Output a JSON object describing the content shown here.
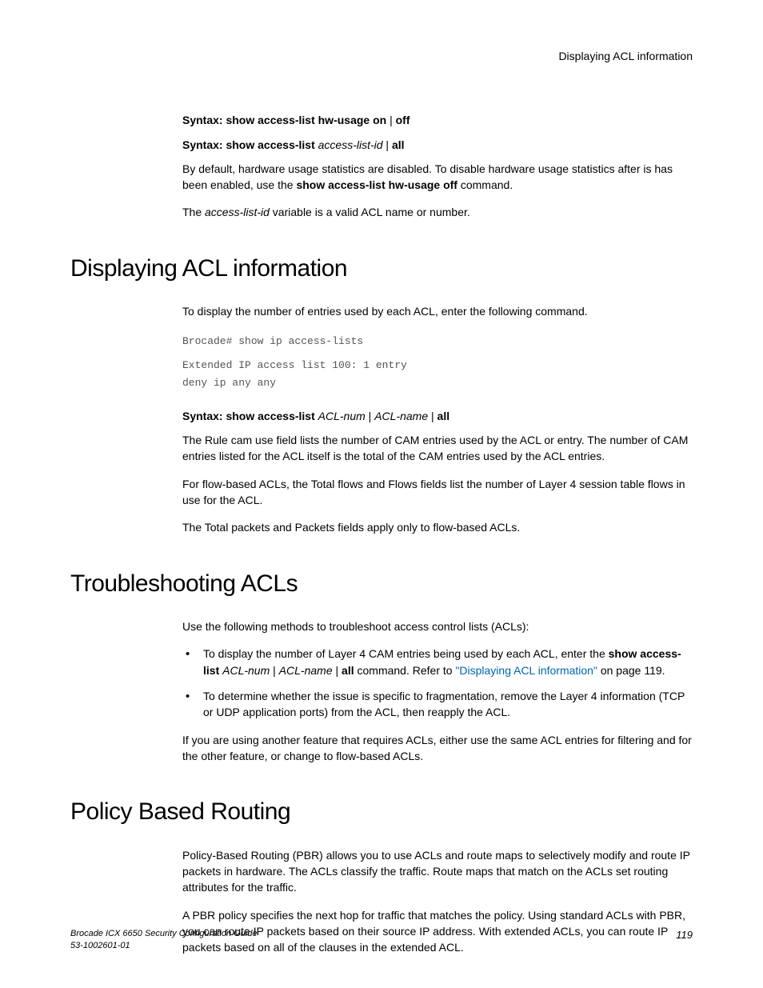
{
  "header": {
    "right": "Displaying ACL information"
  },
  "intro": {
    "syntax1": {
      "prefix": "Syntax:  ",
      "cmd": "show access-list hw-usage on",
      "sep": " | ",
      "off": "off"
    },
    "syntax2": {
      "prefix": "Syntax:  ",
      "cmd": "show access-list ",
      "var": "access-list-id",
      "sep": " | ",
      "all": "all"
    },
    "para1a": "By default, hardware usage statistics are disabled. To disable hardware usage statistics after is has been enabled, use the ",
    "para1b": "show access-list hw-usage off",
    "para1c": " command.",
    "para2a": "The ",
    "para2b": "access-list-id",
    "para2c": " variable is a valid ACL name or number."
  },
  "sec1": {
    "title": "Displaying ACL information",
    "p1": "To display the number of entries used by each ACL, enter the following command.",
    "code1": "Brocade# show ip access-lists",
    "code2": "Extended IP access list 100: 1 entry",
    "code3": "deny ip any any",
    "syntax": {
      "prefix": "Syntax:  ",
      "cmd": "show access-list ",
      "var1": "ACL-num",
      "sep1": " | ",
      "var2": "ACL-name",
      "sep2": " | ",
      "all": "all"
    },
    "p2": "The Rule cam use field lists the number of CAM entries used by the ACL or entry. The number of CAM entries listed for the ACL itself is the total of the CAM entries used by the ACL entries.",
    "p3": "For flow-based ACLs, the Total flows and Flows fields list the number of Layer 4 session table flows in use for the ACL.",
    "p4": "The Total packets and Packets fields apply only to flow-based ACLs."
  },
  "sec2": {
    "title": "Troubleshooting ACLs",
    "p1": "Use the following methods to troubleshoot access control lists (ACLs):",
    "li1a": "To display the number of Layer 4 CAM entries being used by each ACL, enter the ",
    "li1b": "show access-list ",
    "li1c": "ACL-num",
    "li1d": " | ",
    "li1e": "ACL-name",
    "li1f": " | ",
    "li1g": "all",
    "li1h": " command. Refer to ",
    "li1link": "\"Displaying ACL information\"",
    "li1i": " on page 119.",
    "li2": "To determine whether the issue is specific to fragmentation, remove the Layer 4 information (TCP or UDP application ports) from the ACL, then reapply the ACL.",
    "p2": "If you are using another feature that requires ACLs, either use the same ACL entries for filtering and for the other feature, or change to flow-based ACLs."
  },
  "sec3": {
    "title": "Policy Based Routing",
    "p1": "Policy-Based Routing (PBR) allows you to use ACLs and route maps to selectively modify and route IP packets in hardware. The ACLs classify the traffic. Route maps that match on the ACLs set routing attributes for the traffic.",
    "p2": "A PBR policy specifies the next hop for traffic that matches the policy. Using standard ACLs with PBR, you can route IP packets based on their source IP address. With extended ACLs, you can route IP packets based on all of the clauses in the extended ACL."
  },
  "footer": {
    "title": "Brocade ICX 6650 Security Configuration Guide",
    "docnum": "53-1002601-01",
    "page": "119"
  }
}
